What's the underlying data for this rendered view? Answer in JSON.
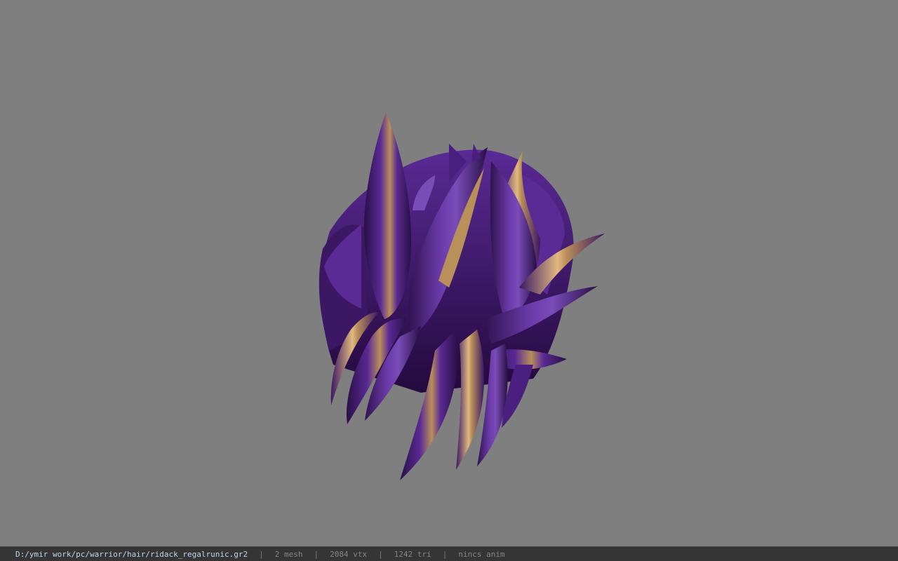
{
  "viewer": {
    "background_color": "#7f7f7f",
    "model_colors": {
      "purple_dark": "#2a0f45",
      "purple_mid": "#4a1f80",
      "purple_light": "#7a4cb8",
      "gold": "#b98f5a",
      "gold_light": "#e0b97f"
    }
  },
  "status": {
    "file_path": "D:/ymir work/pc/warrior/hair/ridack_regalrunic.gr2",
    "mesh": "2 mesh",
    "vtx": "2084 vtx",
    "tri": "1242 tri",
    "anim": "nincs anim",
    "separator": "|"
  }
}
